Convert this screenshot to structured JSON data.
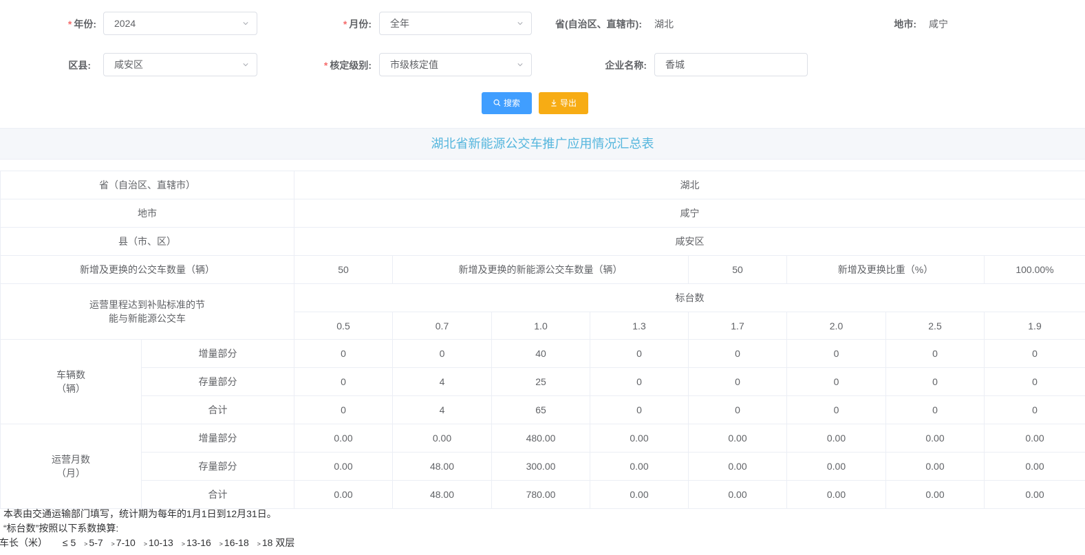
{
  "filters": {
    "year": {
      "label": "年份:",
      "value": "2024",
      "required": true
    },
    "month": {
      "label": "月份:",
      "value": "全年",
      "required": true
    },
    "province": {
      "label": "省(自治区、直辖市):",
      "value": "湖北"
    },
    "city": {
      "label": "地市:",
      "value": "咸宁"
    },
    "county": {
      "label": "区县:",
      "value": "咸安区"
    },
    "level": {
      "label": "核定级别:",
      "value": "市级核定值",
      "required": true
    },
    "company": {
      "label": "企业名称:",
      "value": "香城"
    },
    "required_mark": "*"
  },
  "actions": {
    "search_label": "搜索",
    "export_label": "导出"
  },
  "report": {
    "title": "湖北省新能源公交车推广应用情况汇总表",
    "province_label": "省（自治区、直辖市）",
    "province_value": "湖北",
    "city_label": "地市",
    "city_value": "咸宁",
    "county_label": "县（市、区）",
    "county_value": "咸安区",
    "new_bus_label": "新增及更换的公交车数量（辆）",
    "new_bus_value": "50",
    "new_ne_bus_label": "新增及更换的新能源公交车数量（辆）",
    "new_ne_bus_value": "50",
    "ratio_label": "新增及更换比重（%）",
    "ratio_value": "100.00%",
    "mileage_label_line1": "运营里程达到补贴标准的节",
    "mileage_label_line2": "能与新能源公交车",
    "standard_units_label": "标台数",
    "coefficients": [
      "0.5",
      "0.7",
      "1.0",
      "1.3",
      "1.7",
      "2.0",
      "2.5",
      "1.9"
    ],
    "vehicles_label_line1": "车辆数",
    "vehicles_label_line2": "（辆）",
    "months_label_line1": "运营月数",
    "months_label_line2": "（月）",
    "increment_label": "增量部分",
    "stock_label": "存量部分",
    "total_label": "合计",
    "vehicles": {
      "increment": [
        "0",
        "0",
        "40",
        "0",
        "0",
        "0",
        "0",
        "0"
      ],
      "stock": [
        "0",
        "4",
        "25",
        "0",
        "0",
        "0",
        "0",
        "0"
      ],
      "total": [
        "0",
        "4",
        "65",
        "0",
        "0",
        "0",
        "0",
        "0"
      ]
    },
    "months": {
      "increment": [
        "0.00",
        "0.00",
        "480.00",
        "0.00",
        "0.00",
        "0.00",
        "0.00",
        "0.00"
      ],
      "stock": [
        "0.00",
        "48.00",
        "300.00",
        "0.00",
        "0.00",
        "0.00",
        "0.00",
        "0.00"
      ],
      "total": [
        "0.00",
        "48.00",
        "780.00",
        "0.00",
        "0.00",
        "0.00",
        "0.00",
        "0.00"
      ]
    }
  },
  "notes": {
    "line1": "本表由交通运输部门填写，统计期为每年的1月1日到12月31日。",
    "line2": "“标台数”按照以下系数换算:",
    "length_label": "车长（米）",
    "ranges": [
      "≤ 5",
      "5-7",
      "7-10",
      "10-13",
      "13-16",
      "16-18",
      "18 双层"
    ],
    "gt_mark": ">"
  }
}
